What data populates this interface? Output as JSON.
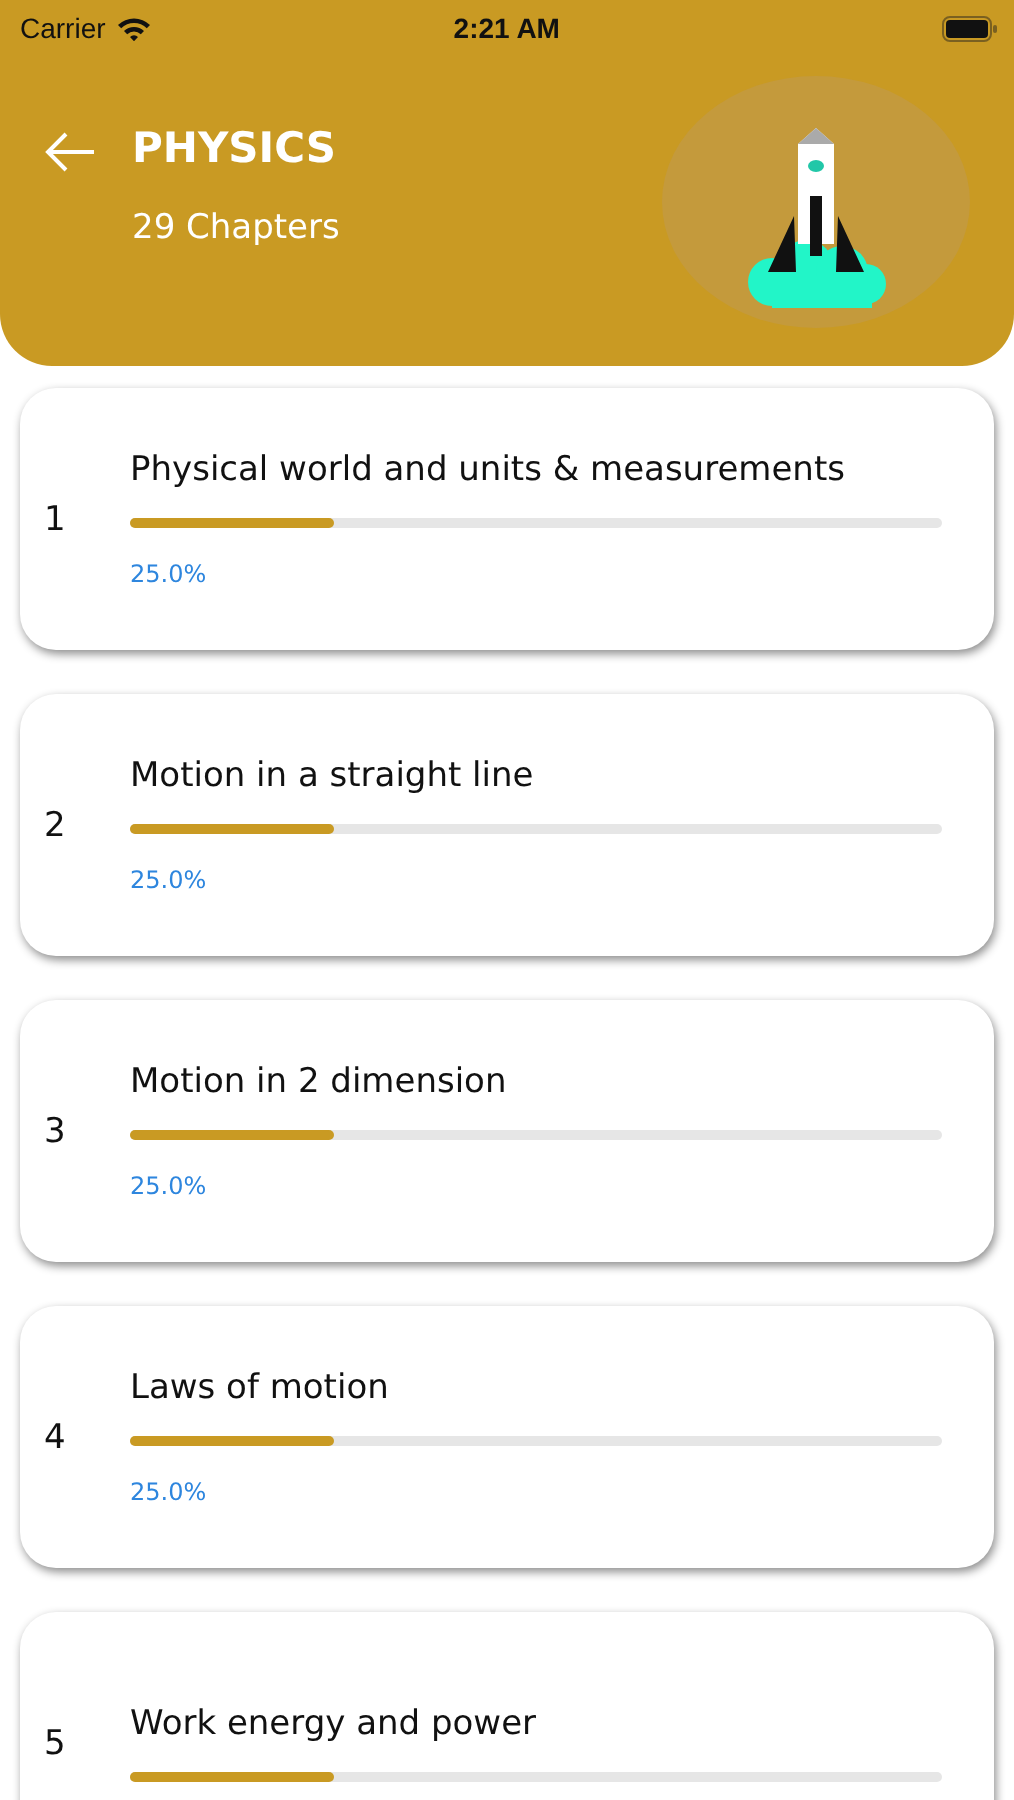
{
  "status_bar": {
    "carrier": "Carrier",
    "time": "2:21 AM"
  },
  "header": {
    "title": "PHYSICS",
    "subtitle": "29 Chapters"
  },
  "chapters": [
    {
      "number": "1",
      "title": "Physical world and units & measurements",
      "level": 0.25,
      "percent": "25.0%"
    },
    {
      "number": "2",
      "title": "Motion in a straight line",
      "level": 0.25,
      "percent": "25.0%"
    },
    {
      "number": "3",
      "title": "Motion in 2 dimension",
      "level": 0.25,
      "percent": "25.0%"
    },
    {
      "number": "4",
      "title": "Laws of motion",
      "level": 0.25,
      "percent": "25.0%"
    },
    {
      "number": "5",
      "title": "Work energy and power",
      "level": 0.25
    }
  ]
}
